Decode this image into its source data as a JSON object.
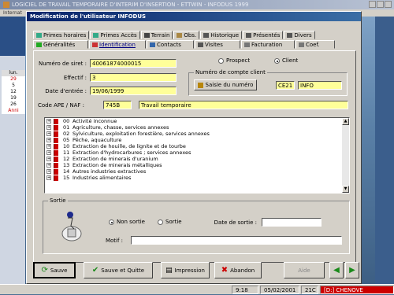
{
  "background": {
    "title": "LOGICIEL DE TRAVAIL TEMPORAIRE D'INTERIM D'INSERTION - ETTWIN - INFODUS 1999",
    "menu": "Internat",
    "calendar": {
      "header": "lun.",
      "days": [
        "",
        "29",
        "5",
        "12",
        "19",
        "26"
      ],
      "days2": [
        "",
        "",
        "",
        "",
        "",
        "2"
      ],
      "label": "Anni"
    }
  },
  "taskbar": {
    "time": "9:18",
    "date": "05/02/2001",
    "code": "21C",
    "drive": "[D:] CHENOVE"
  },
  "dialog": {
    "title": "Modification de l'utilisateur INFODUS",
    "tabs_row1": [
      {
        "label": "Primes horaires",
        "icon": "money-icon"
      },
      {
        "label": "Primes Accès",
        "icon": "money-icon"
      },
      {
        "label": "Terrain",
        "icon": "flag-icon"
      },
      {
        "label": "Obs.",
        "icon": "pen-icon"
      },
      {
        "label": "Historique",
        "icon": "folder-icon"
      },
      {
        "label": "Présentés",
        "icon": "folder-icon"
      },
      {
        "label": "Divers",
        "icon": "folder-icon"
      }
    ],
    "tabs_row2": [
      {
        "label": "Généralités",
        "icon": "green-check-icon"
      },
      {
        "label": "Identification",
        "icon": "card-icon",
        "active": true
      },
      {
        "label": "Contacts",
        "icon": "contacts-icon"
      },
      {
        "label": "Visites",
        "icon": "visit-icon"
      },
      {
        "label": "Facturation",
        "icon": "invoice-icon"
      },
      {
        "label": "Coef.",
        "icon": "coef-icon"
      }
    ],
    "fields": {
      "siret_label": "Numéro de siret :",
      "siret_value": "40061874000015",
      "effectif_label": "Effectif :",
      "effectif_value": "3",
      "date_label": "Date d'entrée :",
      "date_value": "19/06/1999",
      "ape_label": "Code APE / NAF :",
      "ape_code": "745B",
      "ape_text": "Travail temporaire"
    },
    "status": {
      "prospect": "Prospect",
      "client": "Client",
      "selected": "client"
    },
    "compte": {
      "title": "Numéro de compte client",
      "button": "Saisie du numéro",
      "code": "CE21",
      "name": "INFO"
    },
    "activities": [
      {
        "code": "00",
        "label": "Activité inconnue"
      },
      {
        "code": "01",
        "label": "Agriculture, chasse, services annexes"
      },
      {
        "code": "02",
        "label": "Sylviculture, exploitation forestière, services annexes"
      },
      {
        "code": "05",
        "label": "Pêche, aquaculture"
      },
      {
        "code": "10",
        "label": "Extraction de houille, de lignite et de tourbe"
      },
      {
        "code": "11",
        "label": "Extraction d'hydrocarbures ; services annexes"
      },
      {
        "code": "12",
        "label": "Extraction de minerais d'uranium"
      },
      {
        "code": "13",
        "label": "Extraction de minerais métalliques"
      },
      {
        "code": "14",
        "label": "Autres industries extractives"
      },
      {
        "code": "15",
        "label": "Industries alimentaires"
      }
    ],
    "sortie": {
      "title": "Sortie",
      "non_sortie": "Non sortie",
      "sortie": "Sortie",
      "date_label": "Date de sortie :",
      "date_value": "",
      "motif_label": "Motif :",
      "motif_value": ""
    },
    "buttons": {
      "sauve": "Sauve",
      "sauve_quitte": "Sauve et Quitte",
      "impression": "Impression",
      "abandon": "Abandon",
      "aide": "Aide"
    }
  }
}
